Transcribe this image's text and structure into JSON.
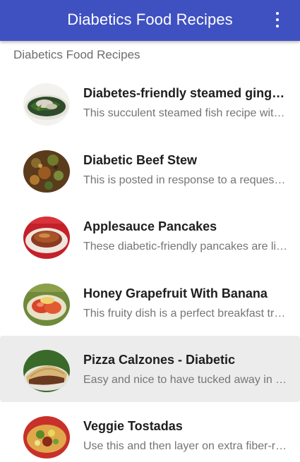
{
  "appbar": {
    "title": "Diabetics Food Recipes",
    "overflow_icon": "more-vert-icon",
    "color": "#3f51c1"
  },
  "section_label": "Diabetics Food Recipes",
  "recipes": [
    {
      "title": "Diabetes-friendly steamed ginger fish",
      "subtitle": "This succulent steamed fish recipe with ginger and greens",
      "thumb_icon": "steamed-fish-photo"
    },
    {
      "title": "Diabetic Beef Stew",
      "subtitle": "This is posted in response to a request for a diabetic stew",
      "thumb_icon": "beef-stew-photo"
    },
    {
      "title": "Applesauce Pancakes",
      "subtitle": "These diabetic-friendly pancakes are light and fluffy",
      "thumb_icon": "pancakes-photo"
    },
    {
      "title": "Honey Grapefruit With Banana",
      "subtitle": "This fruity dish is a perfect breakfast treat",
      "thumb_icon": "grapefruit-banana-photo"
    },
    {
      "title": "Pizza Calzones - Diabetic",
      "subtitle": "Easy and nice to have tucked away in the freezer",
      "thumb_icon": "calzone-photo",
      "highlighted": true
    },
    {
      "title": "Veggie Tostadas",
      "subtitle": "Use this and then layer on extra fiber-rich veggies",
      "thumb_icon": "tostada-photo"
    }
  ]
}
